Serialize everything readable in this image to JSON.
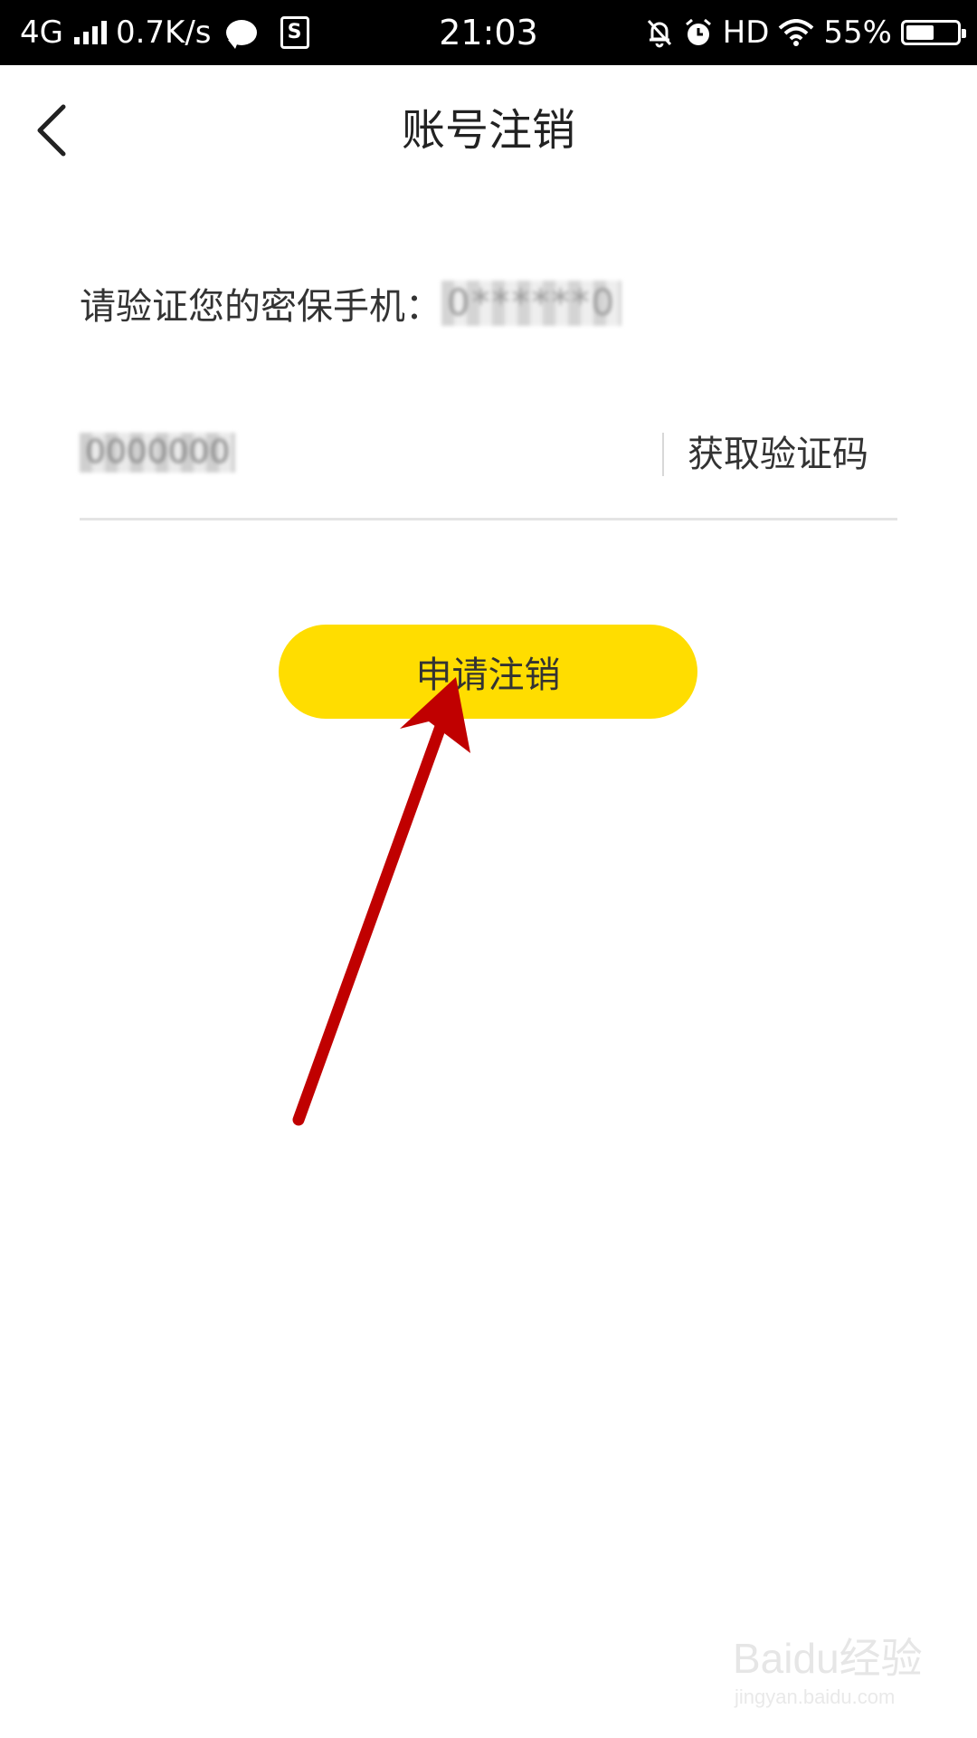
{
  "status_bar": {
    "network": "4G",
    "speed": "0.7K/s",
    "time": "21:03",
    "hd": "HD",
    "battery": "55%",
    "battery_level": 0.55
  },
  "header": {
    "title": "账号注销"
  },
  "verify": {
    "phone_label": "请验证您的密保手机：",
    "phone_value": "0******0",
    "code_value": "0000000",
    "code_placeholder": "",
    "get_code_label": "获取验证码"
  },
  "actions": {
    "apply_label": "申请注销"
  },
  "colors": {
    "accent": "#ffdd00",
    "annotation": "#c00000",
    "status_bar": "#000000"
  },
  "watermark": {
    "brand": "Baidu经验",
    "url": "jingyan.baidu.com"
  }
}
